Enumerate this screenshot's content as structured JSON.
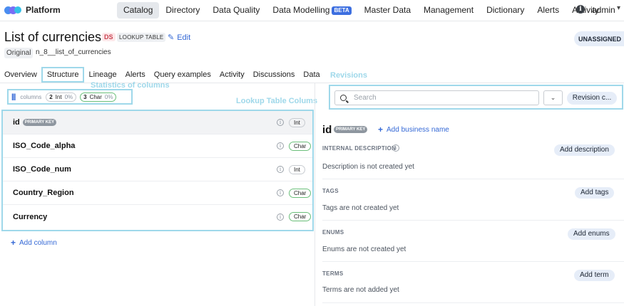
{
  "app": {
    "name": "Platform"
  },
  "nav": {
    "items": [
      {
        "label": "Catalog",
        "active": true
      },
      {
        "label": "Directory"
      },
      {
        "label": "Data Quality"
      },
      {
        "label": "Data Modelling",
        "badge": "BETA"
      },
      {
        "label": "Master Data"
      },
      {
        "label": "Management"
      },
      {
        "label": "Dictionary"
      },
      {
        "label": "Alerts"
      },
      {
        "label": "Activity"
      }
    ],
    "user": "admin"
  },
  "entity": {
    "title": "List of currencies",
    "badge_ds": "DS",
    "badge_type": "LOOKUP TABLE",
    "edit_label": "Edit",
    "original_label": "Original",
    "original_name": "n_8__list_of_currencies",
    "owner_button": "UNASSIGNED"
  },
  "tabs": [
    "Overview",
    "Structure",
    "Lineage",
    "Alerts",
    "Query examples",
    "Activity",
    "Discussions",
    "Data"
  ],
  "annotations": {
    "statistics": "Statistics of columns",
    "lookup_columns": "Lookup Table Colums",
    "revisions": "Revisions"
  },
  "stats": {
    "label": "columns",
    "int_count": "2",
    "int_type": "Int",
    "int_pct": "0%",
    "char_count": "3",
    "char_type": "Char",
    "char_pct": "0%"
  },
  "columns": [
    {
      "name": "id",
      "pk": "PRIMARY KEY",
      "type": "Int"
    },
    {
      "name": "ISO_Code_alpha",
      "type": "Char"
    },
    {
      "name": "ISO_Code_num",
      "type": "Int"
    },
    {
      "name": "Country_Region",
      "type": "Char"
    },
    {
      "name": "Currency",
      "type": "Char"
    }
  ],
  "add_column_label": "Add column",
  "revisions": {
    "search_placeholder": "Search",
    "button_label": "Revision c..."
  },
  "details": {
    "name": "id",
    "pk": "PRIMARY KEY",
    "add_business_name": "Add business name",
    "internal_description_label": "INTERNAL DESCRIPTION",
    "internal_description_text": "Description is not created yet",
    "add_description": "Add description",
    "tags_label": "TAGS",
    "tags_text": "Tags are not created yet",
    "add_tags": "Add tags",
    "enums_label": "ENUMS",
    "enums_text": "Enums are not created yet",
    "add_enums": "Add enums",
    "terms_label": "TERMS",
    "terms_text": "Terms are not added yet",
    "add_term": "Add term"
  },
  "colors": {
    "accent": "#3569d6",
    "highlight": "#9fd8ea",
    "char_pill": "#6bbf7a"
  }
}
